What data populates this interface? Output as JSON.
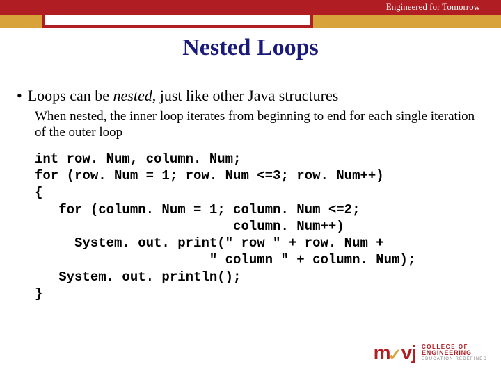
{
  "header": {
    "tagline": "Engineered for Tomorrow",
    "title": "Nested Loops"
  },
  "bullet": {
    "marker": "•",
    "text_pre": "Loops can be ",
    "text_em": "nested",
    "text_post": ", just like other Java structures"
  },
  "sub_para": "When nested, the inner loop iterates from beginning to end for each single iteration of the outer loop",
  "code": "int row. Num, column. Num;\nfor (row. Num = 1; row. Num <=3; row. Num++)\n{\n   for (column. Num = 1; column. Num <=2;\n                         column. Num++)\n     System. out. print(\" row \" + row. Num +\n                      \" column \" + column. Num);\n   System. out. println();\n}",
  "logo": {
    "mark_m": "m",
    "mark_vj": "vj",
    "line1": "COLLEGE OF",
    "line2": "ENGINEERING",
    "line3": "EDUCATION REDEFINED"
  }
}
